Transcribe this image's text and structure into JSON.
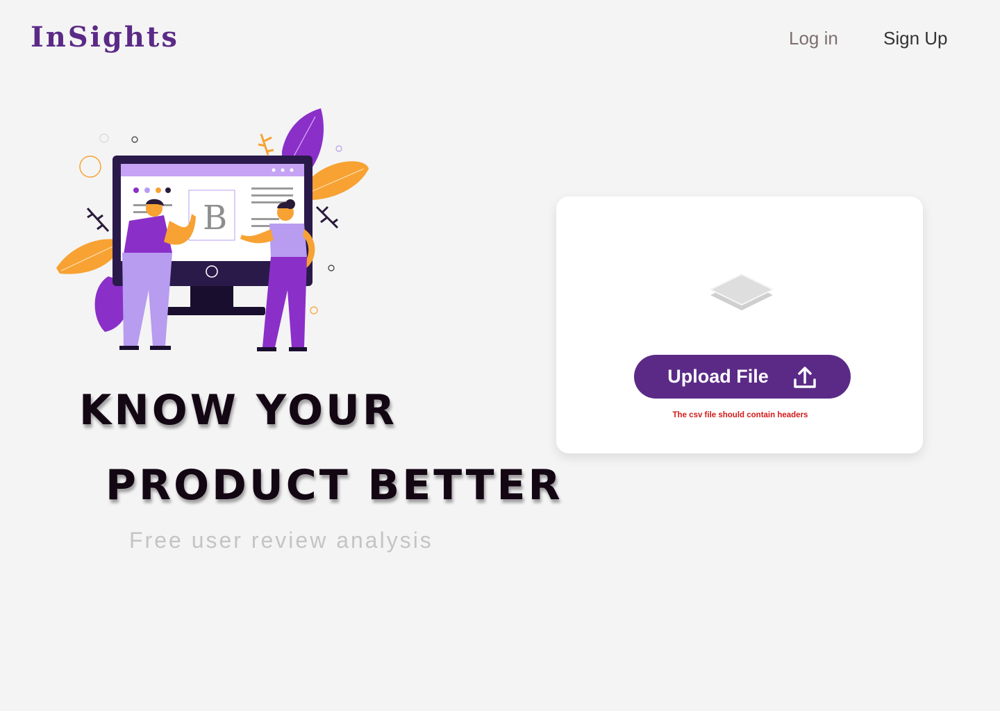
{
  "header": {
    "logo": "InSights",
    "login_label": "Log in",
    "signup_label": "Sign Up"
  },
  "hero": {
    "line1": "KNOW YOUR",
    "line2": "PRODUCT BETTER",
    "subtitle": "Free user review analysis",
    "illustration_letter": "B"
  },
  "upload": {
    "button_label": "Upload File",
    "hint": "The csv file should contain headers",
    "icons": {
      "dropzone": "layers-icon",
      "button": "upload-arrow-icon"
    }
  },
  "colors": {
    "brand": "#5b2a86",
    "background": "#f4f4f4",
    "hint": "#d11a1a",
    "accent_orange": "#f7a233",
    "accent_purple": "#8b2fc9"
  }
}
